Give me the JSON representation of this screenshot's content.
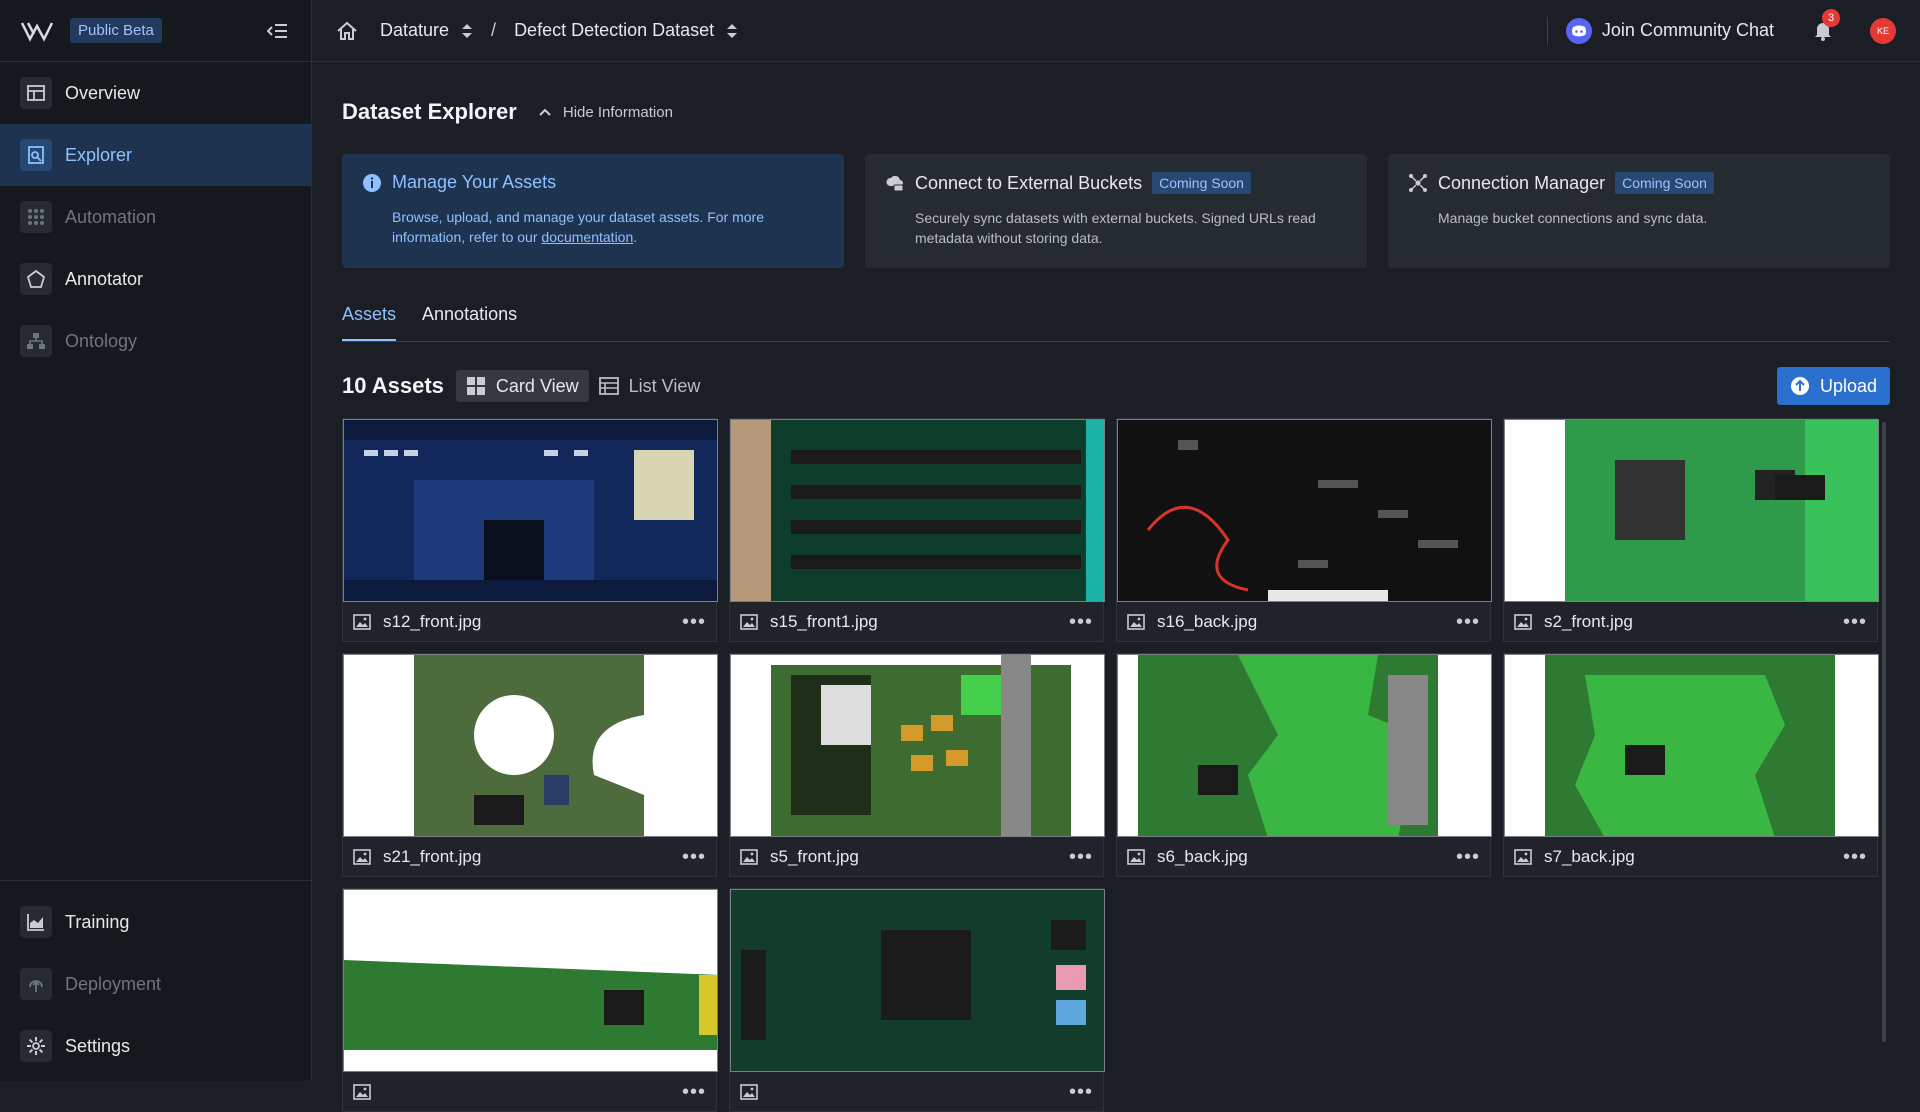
{
  "sidebar": {
    "beta_label": "Public Beta",
    "items": [
      {
        "label": "Overview",
        "icon": "overview-icon",
        "state": "normal"
      },
      {
        "label": "Explorer",
        "icon": "explorer-icon",
        "state": "active"
      },
      {
        "label": "Automation",
        "icon": "automation-icon",
        "state": "disabled"
      },
      {
        "label": "Annotator",
        "icon": "annotator-icon",
        "state": "normal"
      },
      {
        "label": "Ontology",
        "icon": "ontology-icon",
        "state": "disabled"
      }
    ],
    "bottom_items": [
      {
        "label": "Training",
        "icon": "training-icon",
        "state": "normal"
      },
      {
        "label": "Deployment",
        "icon": "deployment-icon",
        "state": "disabled"
      },
      {
        "label": "Settings",
        "icon": "gear-icon",
        "state": "normal"
      }
    ]
  },
  "topbar": {
    "project": "Datature",
    "separator": "/",
    "dataset": "Defect Detection Dataset",
    "community_label": "Join Community Chat",
    "notification_count": "3",
    "avatar_initials": "KE"
  },
  "explorer": {
    "title": "Dataset Explorer",
    "hide_info_label": "Hide Information",
    "cards": [
      {
        "title": "Manage Your Assets",
        "desc_prefix": "Browse, upload, and manage your dataset assets. For more information, refer to our ",
        "link": "documentation",
        "desc_suffix": ".",
        "badge": ""
      },
      {
        "title": "Connect to External Buckets",
        "desc": "Securely sync datasets with external buckets. Signed URLs read metadata without storing data.",
        "badge": "Coming Soon"
      },
      {
        "title": "Connection Manager",
        "desc": "Manage bucket connections and sync data.",
        "badge": "Coming Soon"
      }
    ],
    "tabs": [
      "Assets",
      "Annotations"
    ],
    "asset_count": "10 Assets",
    "card_view_label": "Card View",
    "list_view_label": "List View",
    "upload_label": "Upload",
    "more_label": "•••",
    "assets": [
      {
        "name": "s12_front.jpg"
      },
      {
        "name": "s15_front1.jpg"
      },
      {
        "name": "s16_back.jpg"
      },
      {
        "name": "s2_front.jpg"
      },
      {
        "name": "s21_front.jpg"
      },
      {
        "name": "s5_front.jpg"
      },
      {
        "name": "s6_back.jpg"
      },
      {
        "name": "s7_back.jpg"
      },
      {
        "name": ""
      },
      {
        "name": ""
      }
    ]
  },
  "colors": {
    "accent": "#8fc0ff",
    "active_bg": "#1e3350",
    "upload_button": "#2b6fcf",
    "badge_red": "#e53935"
  }
}
